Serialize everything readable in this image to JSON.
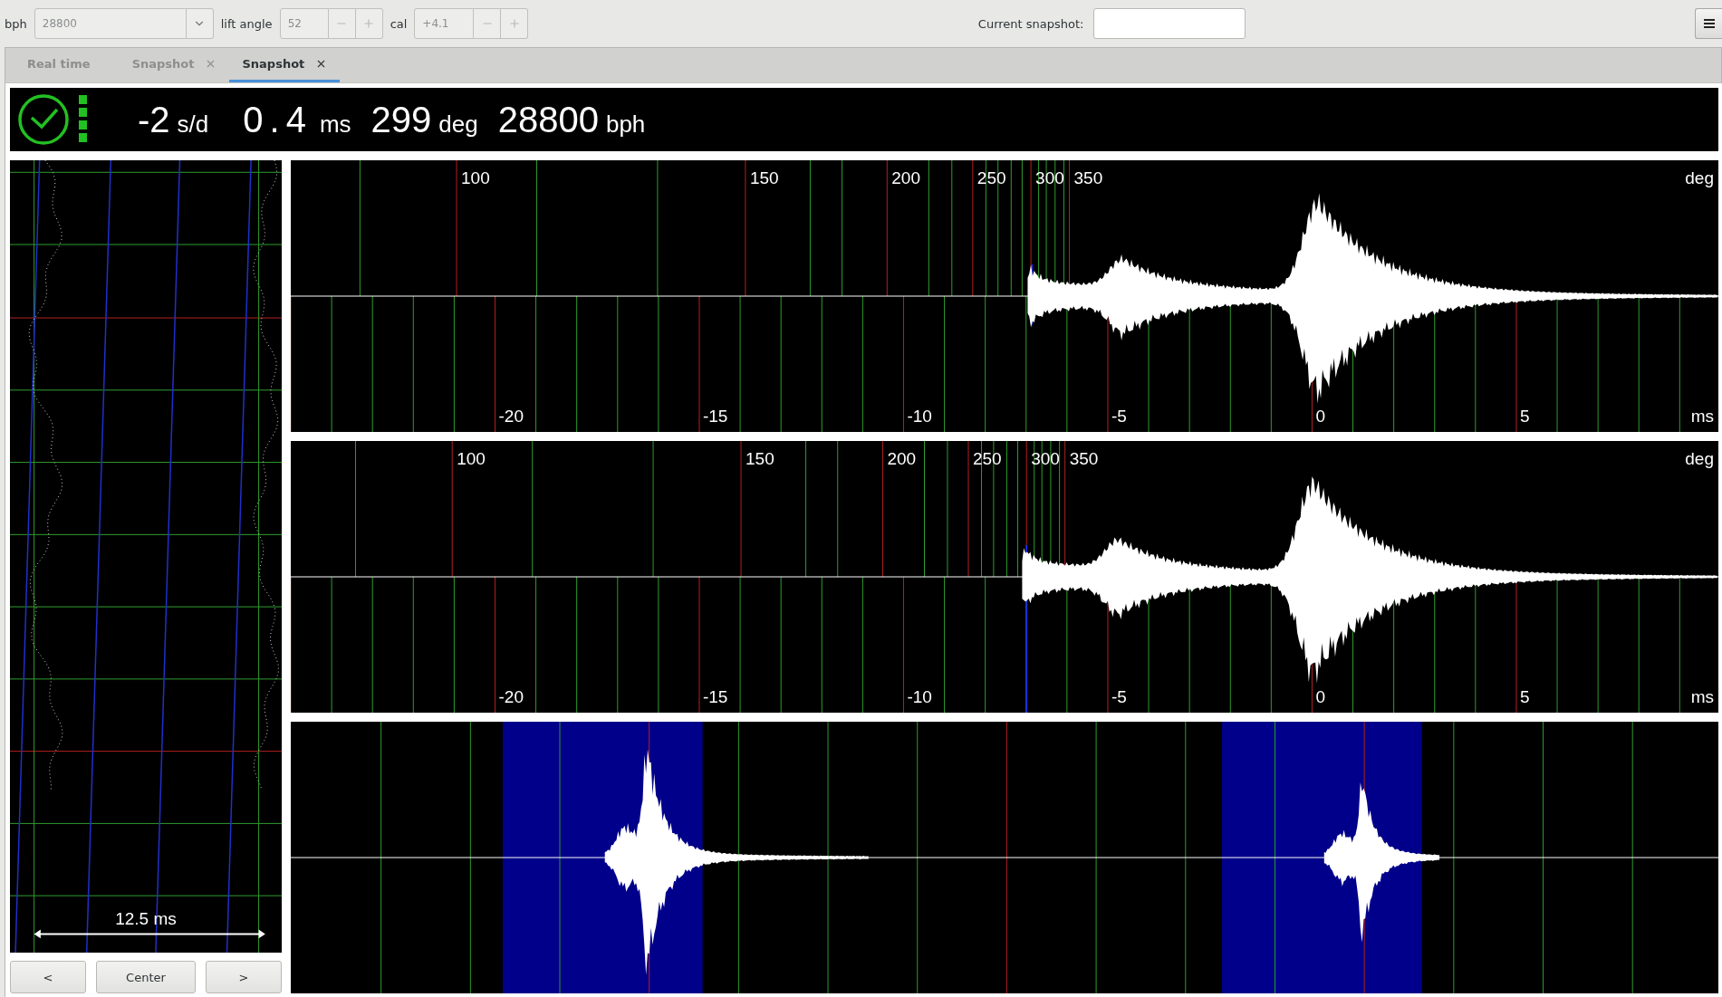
{
  "toolbar": {
    "bph": {
      "label": "bph",
      "value": "28800",
      "disabled": true
    },
    "lift_angle": {
      "label": "lift angle",
      "value": "52",
      "disabled": true
    },
    "cal": {
      "label": "cal",
      "value": "+4.1",
      "disabled": true
    },
    "snapshot": {
      "label": "Current snapshot:"
    }
  },
  "tabs": [
    {
      "label": "Real time",
      "closable": false,
      "selected": false
    },
    {
      "label": "Snapshot",
      "closable": true,
      "selected": false
    },
    {
      "label": "Snapshot",
      "closable": true,
      "selected": true
    }
  ],
  "readings": [
    {
      "value": "-2",
      "unit": "s/d"
    },
    {
      "value": "0.4",
      "unit": "ms"
    },
    {
      "value": "299",
      "unit": "deg"
    },
    {
      "value": "28800",
      "unit": "bph"
    }
  ],
  "paperstrip": {
    "scale_label": "12.5 ms"
  },
  "strip_buttons": [
    "<",
    "Center",
    ">"
  ],
  "plots": [
    {
      "kind": "tick",
      "deg_labels": [
        "100",
        "150",
        "200",
        "250",
        "300",
        "350"
      ],
      "deg_unit": "deg",
      "ms_labels": [
        "-20",
        "-15",
        "-10",
        "-5",
        "0",
        "5"
      ],
      "ms_unit": "ms"
    },
    {
      "kind": "tock",
      "deg_labels": [
        "100",
        "150",
        "200",
        "250",
        "300",
        "350"
      ],
      "deg_unit": "deg",
      "ms_labels": [
        "-20",
        "-15",
        "-10",
        "-5",
        "0",
        "5"
      ],
      "ms_unit": "ms"
    },
    {
      "kind": "period"
    }
  ]
}
